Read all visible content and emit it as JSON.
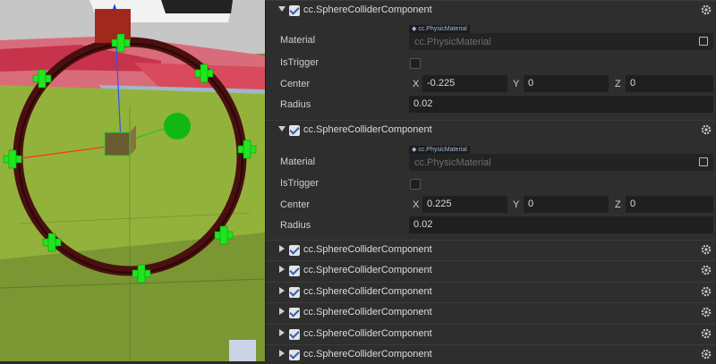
{
  "components": [
    {
      "title": "cc.SphereColliderComponent",
      "expanded": true,
      "enabled": true,
      "material_label": "Material",
      "material_tag": "cc.PhysicMaterial",
      "material_value": "cc.PhysicMaterial",
      "istrigger_label": "IsTrigger",
      "center_label": "Center",
      "radius_label": "Radius",
      "center_x": "-0.225",
      "center_y": "0",
      "center_z": "0",
      "radius": "0.02"
    },
    {
      "title": "cc.SphereColliderComponent",
      "expanded": true,
      "enabled": true,
      "material_label": "Material",
      "material_tag": "cc.PhysicMaterial",
      "material_value": "cc.PhysicMaterial",
      "istrigger_label": "IsTrigger",
      "center_label": "Center",
      "radius_label": "Radius",
      "center_x": "0.225",
      "center_y": "0",
      "center_z": "0",
      "radius": "0.02"
    },
    {
      "title": "cc.SphereColliderComponent",
      "expanded": false,
      "enabled": true
    },
    {
      "title": "cc.SphereColliderComponent",
      "expanded": false,
      "enabled": true
    },
    {
      "title": "cc.SphereColliderComponent",
      "expanded": false,
      "enabled": true
    },
    {
      "title": "cc.SphereColliderComponent",
      "expanded": false,
      "enabled": true
    },
    {
      "title": "cc.SphereColliderComponent",
      "expanded": false,
      "enabled": true
    }
  ],
  "axes": {
    "x": "X",
    "y": "Y",
    "z": "Z"
  },
  "icons": {
    "gear": "gear-icon",
    "expand": "caret-down-icon",
    "collapsed": "caret-right-icon",
    "material_picker": "asset-picker-icon",
    "tag_dot": "diamond-icon"
  },
  "colors": {
    "ring": "#4a1010",
    "gizmo_handle": "#1ee61e",
    "ground": "#8fb23a",
    "checkbox_mark": "#2b5fb3"
  }
}
